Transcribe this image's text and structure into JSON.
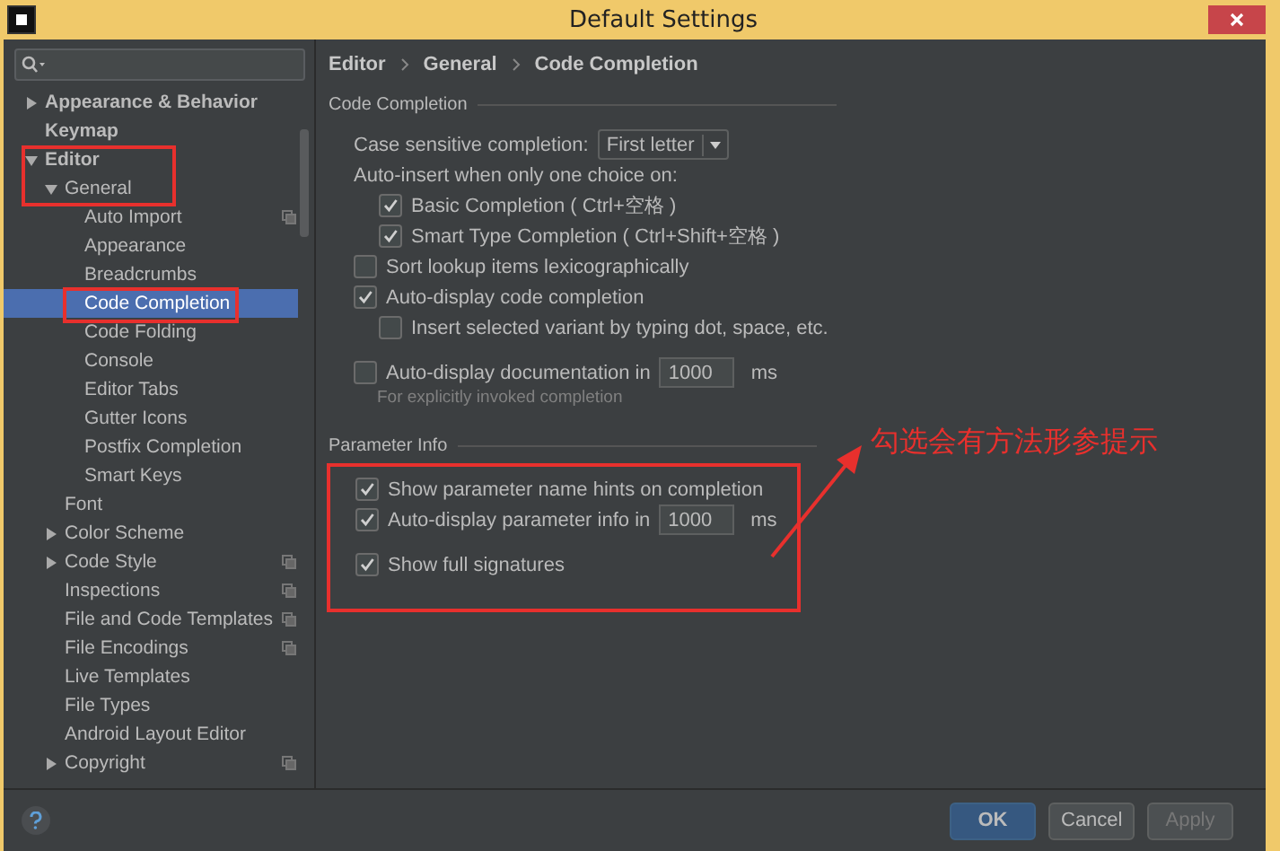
{
  "window": {
    "title": "Default Settings"
  },
  "tree": [
    {
      "label": "Appearance & Behavior",
      "expanded": false,
      "selected": false,
      "per_project": false
    },
    {
      "label": "Keymap",
      "selected": false,
      "per_project": false
    },
    {
      "label": "Editor",
      "expanded": true,
      "selected": false,
      "per_project": false,
      "children": [
        {
          "label": "General",
          "expanded": true,
          "selected": false,
          "per_project": false,
          "children": [
            {
              "label": "Auto Import",
              "selected": false,
              "per_project": true
            },
            {
              "label": "Appearance",
              "selected": false,
              "per_project": false
            },
            {
              "label": "Breadcrumbs",
              "selected": false,
              "per_project": false
            },
            {
              "label": "Code Completion",
              "selected": true,
              "per_project": false
            },
            {
              "label": "Code Folding",
              "selected": false,
              "per_project": false
            },
            {
              "label": "Console",
              "selected": false,
              "per_project": false
            },
            {
              "label": "Editor Tabs",
              "selected": false,
              "per_project": false
            },
            {
              "label": "Gutter Icons",
              "selected": false,
              "per_project": false
            },
            {
              "label": "Postfix Completion",
              "selected": false,
              "per_project": false
            },
            {
              "label": "Smart Keys",
              "selected": false,
              "per_project": false
            }
          ]
        },
        {
          "label": "Font",
          "selected": false,
          "per_project": false
        },
        {
          "label": "Color Scheme",
          "expanded": false,
          "selected": false,
          "per_project": false
        },
        {
          "label": "Code Style",
          "expanded": false,
          "selected": false,
          "per_project": true
        },
        {
          "label": "Inspections",
          "selected": false,
          "per_project": true
        },
        {
          "label": "File and Code Templates",
          "selected": false,
          "per_project": true
        },
        {
          "label": "File Encodings",
          "selected": false,
          "per_project": true
        },
        {
          "label": "Live Templates",
          "selected": false,
          "per_project": false
        },
        {
          "label": "File Types",
          "selected": false,
          "per_project": false
        },
        {
          "label": "Android Layout Editor",
          "selected": false,
          "per_project": false
        },
        {
          "label": "Copyright",
          "expanded": false,
          "selected": false,
          "per_project": true
        }
      ]
    }
  ],
  "breadcrumb": [
    "Editor",
    "General",
    "Code Completion"
  ],
  "sections": [
    {
      "title": "Code Completion",
      "items": [
        {
          "kind": "select",
          "label": "Case sensitive completion:",
          "value": "First letter"
        },
        {
          "kind": "label",
          "label": "Auto-insert when only one choice on:",
          "children": [
            {
              "kind": "checkbox",
              "label": "Basic Completion ( Ctrl+空格 )",
              "checked": true
            },
            {
              "kind": "checkbox",
              "label": "Smart Type Completion ( Ctrl+Shift+空格 )",
              "checked": true
            }
          ]
        },
        {
          "kind": "checkbox",
          "label": "Sort lookup items lexicographically",
          "checked": false
        },
        {
          "kind": "checkbox",
          "label": "Auto-display code completion",
          "checked": true,
          "children": [
            {
              "kind": "checkbox",
              "label": "Insert selected variant by typing dot, space, etc.",
              "checked": false
            }
          ]
        },
        {
          "kind": "delay",
          "label": "Auto-display documentation in",
          "checked": false,
          "value": "1000",
          "unit": "ms",
          "hint": "For explicitly invoked completion"
        }
      ]
    },
    {
      "title": "Parameter Info",
      "highlighted": true,
      "items": [
        {
          "kind": "checkbox",
          "label": "Show parameter name hints on completion",
          "checked": true
        },
        {
          "kind": "delay",
          "label": "Auto-display parameter info in",
          "checked": true,
          "value": "1000",
          "unit": "ms"
        },
        {
          "kind": "checkbox",
          "label": "Show full signatures",
          "checked": true
        }
      ]
    }
  ],
  "buttons": [
    {
      "label": "OK",
      "kind": "primary",
      "disabled": false
    },
    {
      "label": "Cancel",
      "kind": "default",
      "disabled": false
    },
    {
      "label": "Apply",
      "kind": "default",
      "disabled": true
    }
  ],
  "annotation": {
    "text": "勾选会有方法形参提示"
  }
}
